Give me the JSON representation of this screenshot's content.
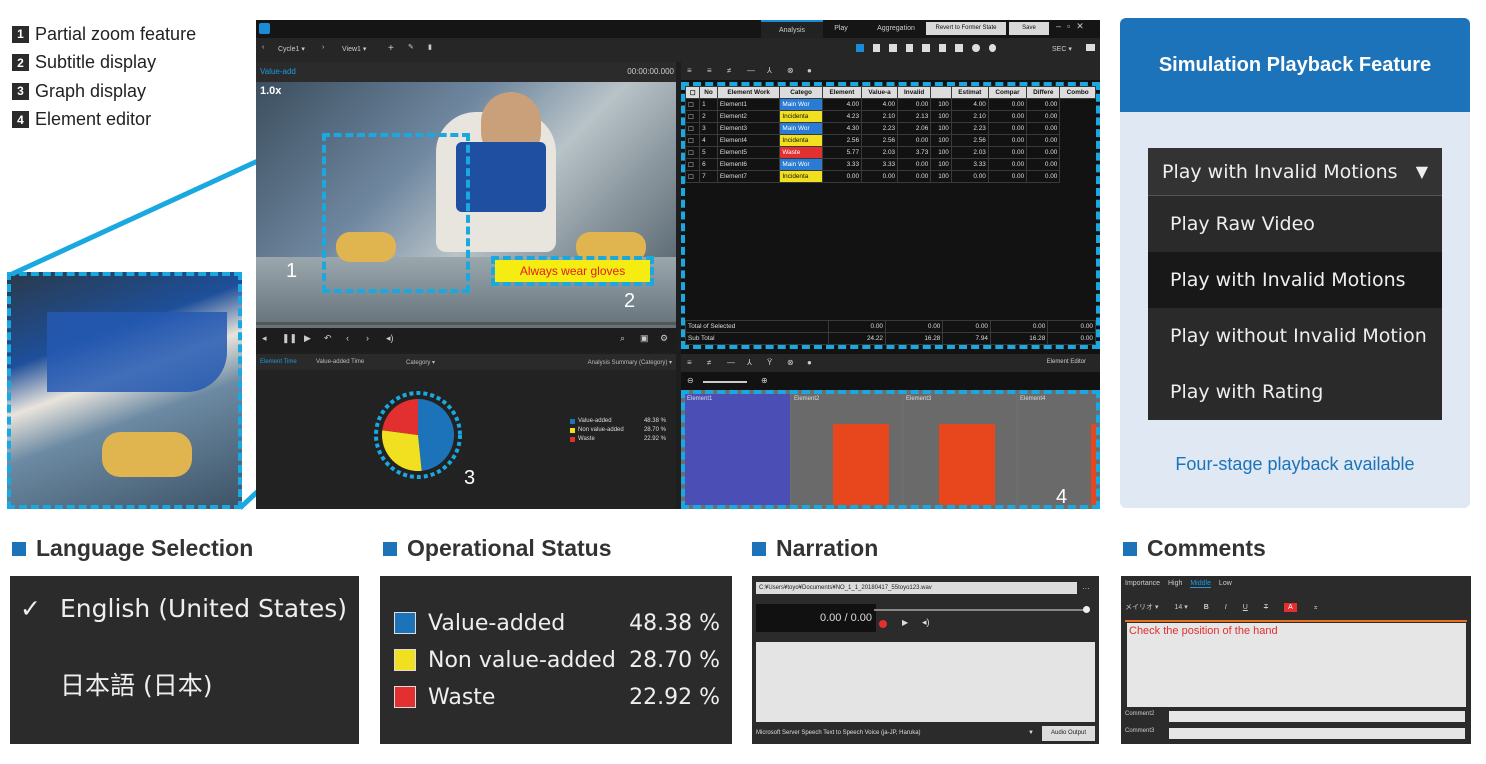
{
  "features": [
    {
      "num": "1",
      "label": "Partial zoom feature"
    },
    {
      "num": "2",
      "label": "Subtitle display"
    },
    {
      "num": "3",
      "label": "Graph display"
    },
    {
      "num": "4",
      "label": "Element editor"
    }
  ],
  "app": {
    "tabs": [
      "Analysis",
      "Play",
      "Aggregation"
    ],
    "buttons": {
      "revert": "Revert to Former State",
      "save": "Save"
    },
    "toolbar": {
      "cycle": "Cycle1",
      "view": "View1",
      "unit": "SEC"
    },
    "video": {
      "title": "Value-add",
      "time": "00:00:00.000",
      "zoom": "1.0x",
      "subtitle": "Always wear gloves"
    },
    "marker_labels": [
      "1",
      "2",
      "3",
      "4"
    ],
    "bottom": {
      "tab1": "Element Time",
      "tab2": "Value-added Time",
      "dropdown": "Category",
      "summary": "Analysis Summary (Category)"
    },
    "pie_legend": [
      {
        "label": "Value-added",
        "value": "48.38 %",
        "color": "#1c73b9"
      },
      {
        "label": "Non value-added",
        "value": "28.70 %",
        "color": "#f0e020"
      },
      {
        "label": "Waste",
        "value": "22.92 %",
        "color": "#e23030"
      }
    ],
    "table": {
      "headers": [
        "No",
        "Element Work",
        "Catego",
        "Element",
        "Value-a",
        "Invalid",
        "",
        "Estimat",
        "Compar",
        "Differe",
        "Combo"
      ],
      "rows": [
        {
          "no": "1",
          "name": "Element1",
          "cat": "Main Wor",
          "cat_color": "#2a7bd4",
          "c": [
            "4.00",
            "4.00",
            "0.00",
            "100",
            "4.00",
            "0.00",
            "0.00"
          ]
        },
        {
          "no": "2",
          "name": "Element2",
          "cat": "Incidenta",
          "cat_color": "#f0e020",
          "c": [
            "4.23",
            "2.10",
            "2.13",
            "100",
            "2.10",
            "0.00",
            "0.00"
          ]
        },
        {
          "no": "3",
          "name": "Element3",
          "cat": "Main Wor",
          "cat_color": "#2a7bd4",
          "c": [
            "4.30",
            "2.23",
            "2.06",
            "100",
            "2.23",
            "0.00",
            "0.00"
          ]
        },
        {
          "no": "4",
          "name": "Element4",
          "cat": "Incidenta",
          "cat_color": "#f0e020",
          "c": [
            "2.56",
            "2.56",
            "0.00",
            "100",
            "2.56",
            "0.00",
            "0.00"
          ]
        },
        {
          "no": "5",
          "name": "Element5",
          "cat": "Waste",
          "cat_color": "#e23030",
          "c": [
            "5.77",
            "2.03",
            "3.73",
            "100",
            "2.03",
            "0.00",
            "0.00"
          ]
        },
        {
          "no": "6",
          "name": "Element6",
          "cat": "Main Wor",
          "cat_color": "#2a7bd4",
          "c": [
            "3.33",
            "3.33",
            "0.00",
            "100",
            "3.33",
            "0.00",
            "0.00"
          ]
        },
        {
          "no": "7",
          "name": "Element7",
          "cat": "Incidenta",
          "cat_color": "#f0e020",
          "c": [
            "0.00",
            "0.00",
            "0.00",
            "100",
            "0.00",
            "0.00",
            "0.00"
          ]
        }
      ],
      "totals": [
        {
          "label": "Total of Selected",
          "c": [
            "0.00",
            "0.00",
            "0.00",
            "0.00",
            "0.00"
          ]
        },
        {
          "label": "Sub Total",
          "c": [
            "24.22",
            "16.28",
            "7.94",
            "16.28",
            "0.00"
          ]
        }
      ]
    },
    "editor": {
      "title": "Element Editor",
      "elements": [
        "Element1",
        "Element2",
        "Element3",
        "Element4"
      ]
    }
  },
  "simulation": {
    "title": "Simulation Playback Feature",
    "selected": "Play with Invalid Motions",
    "options": [
      "Play Raw Video",
      "Play with Invalid Motions",
      "Play without Invalid Motion",
      "Play with Rating"
    ],
    "note": "Four-stage playback available"
  },
  "language": {
    "title": "Language Selection",
    "options": [
      {
        "label": "English (United States)",
        "checked": true
      },
      {
        "label": "日本語 (日本)",
        "checked": false
      }
    ]
  },
  "status": {
    "title": "Operational Status",
    "items": [
      {
        "label": "Value-added",
        "value": "48.38 %",
        "color": "#1c73b9"
      },
      {
        "label": "Non value-added",
        "value": "28.70 %",
        "color": "#f0e020"
      },
      {
        "label": "Waste",
        "value": "22.92 %",
        "color": "#e23030"
      }
    ]
  },
  "narration": {
    "title": "Narration",
    "path": "C:¥Users¥toyo¥Documents¥NO_1_1_20180417_55toyo123.wav",
    "time": "0.00 / 0.00",
    "voice": "Microsoft Server Speech Text to Speech Voice (ja-JP, Haruka)",
    "button": "Audio Output"
  },
  "comments": {
    "title": "Comments",
    "importance_label": "Importance",
    "importance": [
      "High",
      "Middle",
      "Low"
    ],
    "font": "メイリオ",
    "size": "14",
    "text": "Check the position of the hand",
    "fields": [
      "Comment2",
      "Comment3"
    ]
  }
}
